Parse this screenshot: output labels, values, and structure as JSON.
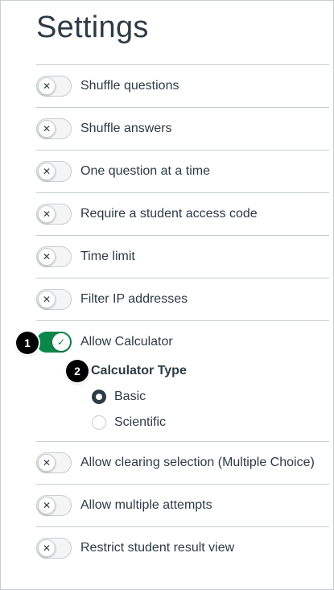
{
  "page": {
    "title": "Settings"
  },
  "settings": {
    "top": [
      {
        "label": "Shuffle questions",
        "enabled": false
      },
      {
        "label": "Shuffle answers",
        "enabled": false
      },
      {
        "label": "One question at a time",
        "enabled": false
      },
      {
        "label": "Require a student access code",
        "enabled": false
      },
      {
        "label": "Time limit",
        "enabled": false
      },
      {
        "label": "Filter IP addresses",
        "enabled": false
      }
    ],
    "calculator": {
      "label": "Allow Calculator",
      "enabled": true,
      "type_title": "Calculator Type",
      "options": [
        {
          "label": "Basic",
          "selected": true
        },
        {
          "label": "Scientific",
          "selected": false
        }
      ]
    },
    "bottom": [
      {
        "label": "Allow clearing selection (Multiple Choice)",
        "enabled": false
      },
      {
        "label": "Allow multiple attempts",
        "enabled": false
      },
      {
        "label": "Restrict student result view",
        "enabled": false
      }
    ]
  },
  "icons": {
    "off": "✕",
    "on": "✓"
  },
  "callouts": [
    "1",
    "2"
  ],
  "colors": {
    "toggle_on": "#0b874b",
    "text": "#2d3b45",
    "divider": "#c7cdd1"
  }
}
